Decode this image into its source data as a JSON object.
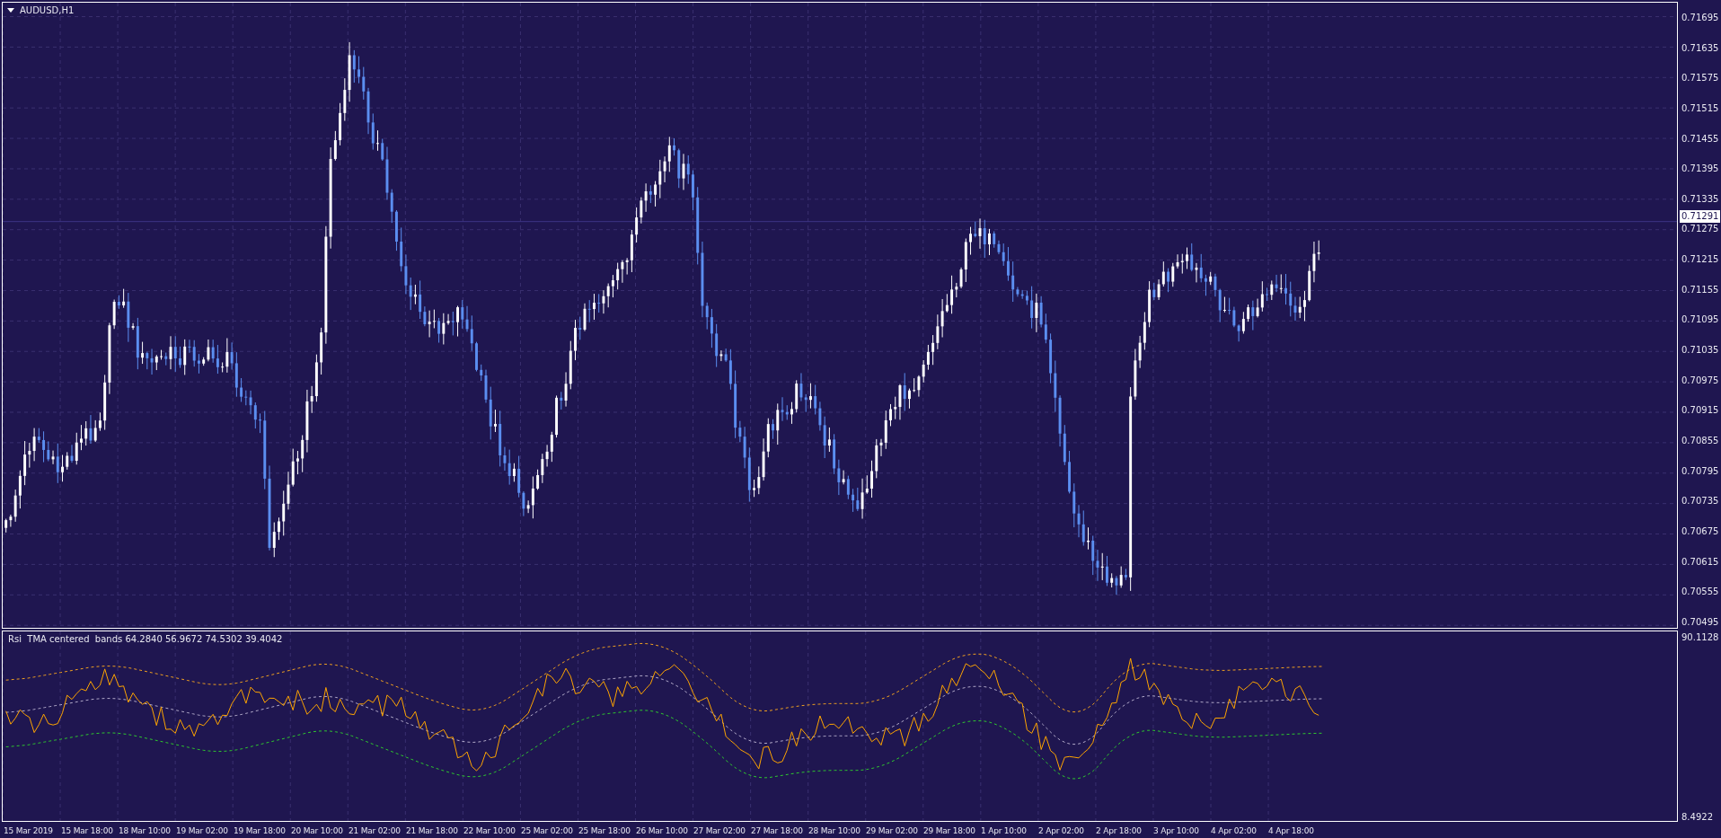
{
  "main_chart": {
    "symbol": "AUDUSD,H1",
    "price_axis": [
      "0.71695",
      "0.71635",
      "0.71575",
      "0.71515",
      "0.71455",
      "0.71395",
      "0.71335",
      "0.71275",
      "0.71215",
      "0.71155",
      "0.71095",
      "0.71035",
      "0.70975",
      "0.70915",
      "0.70855",
      "0.70795",
      "0.70735",
      "0.70675",
      "0.70615",
      "0.70555",
      "0.70495"
    ],
    "current_price": "0.71291"
  },
  "indicator": {
    "title": "Rsi  TMA centered  bands 64.2840 56.9672 74.5302 39.4042",
    "axis_max": "90.1128",
    "axis_min": "8.4922"
  },
  "time_axis": [
    "15 Mar 2019",
    "15 Mar 18:00",
    "18 Mar 10:00",
    "19 Mar 02:00",
    "19 Mar 18:00",
    "20 Mar 10:00",
    "21 Mar 02:00",
    "21 Mar 18:00",
    "22 Mar 10:00",
    "25 Mar 02:00",
    "25 Mar 18:00",
    "26 Mar 10:00",
    "27 Mar 02:00",
    "27 Mar 18:00",
    "28 Mar 10:00",
    "29 Mar 02:00",
    "29 Mar 18:00",
    "1 Apr 10:00",
    "2 Apr 02:00",
    "2 Apr 18:00",
    "3 Apr 10:00",
    "4 Apr 02:00",
    "4 Apr 18:00"
  ]
}
